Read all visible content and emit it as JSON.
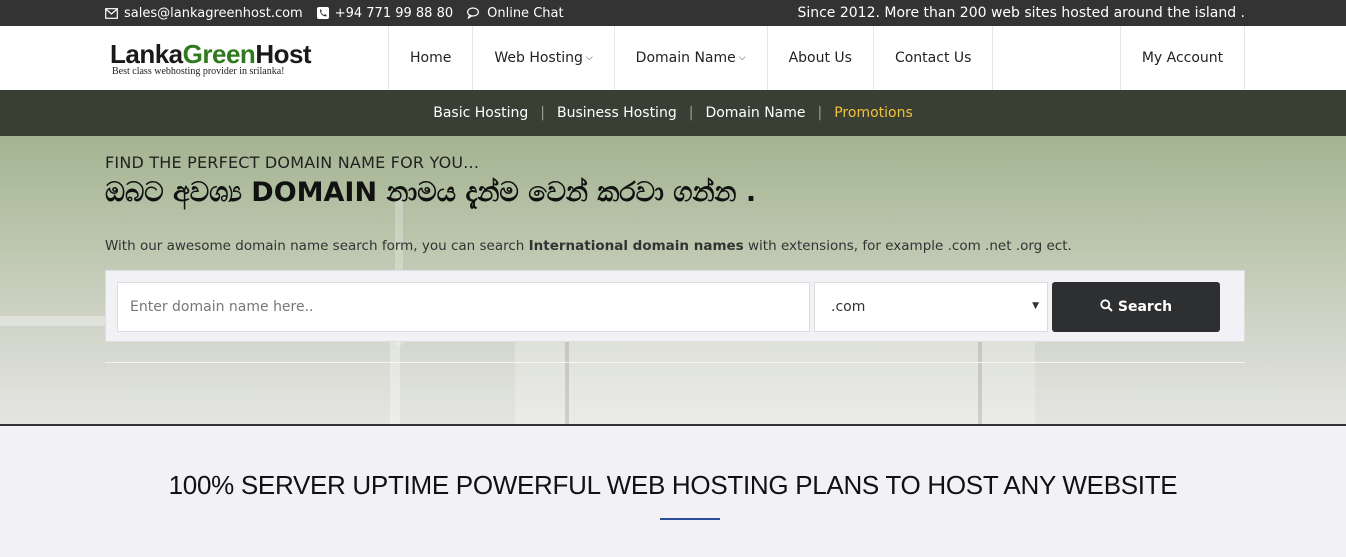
{
  "topbar": {
    "email": "sales@lankagreenhost.com",
    "phone": "+94 771 99 88 80",
    "chat": "Online Chat",
    "since": "Since 2012. More than 200 web sites hosted around the island ."
  },
  "logo": {
    "part1": "Lanka",
    "part2": "Green",
    "part3": "Host",
    "tagline": "Best class webhosting provider in srilanka!"
  },
  "nav": {
    "home": "Home",
    "web_hosting": "Web Hosting",
    "domain_name": "Domain Name",
    "about": "About Us",
    "contact": "Contact Us",
    "account": "My Account"
  },
  "subnav": {
    "basic": "Basic Hosting",
    "business": "Business Hosting",
    "domain": "Domain Name",
    "promotions": "Promotions",
    "separator": "|"
  },
  "hero": {
    "kicker": "FIND THE PERFECT DOMAIN NAME FOR YOU...",
    "headline": "ඔබට අවශ්‍ය DOMAIN නාමය දැන්ම වෙන් කරවා ගන්න .",
    "desc_pre": "With our awesome domain name search form, you can search ",
    "desc_bold": "International domain names",
    "desc_post": " with extensions, for example .com .net .org ect."
  },
  "search": {
    "placeholder": "Enter domain name here..",
    "tld_value": ".com",
    "button_label": "Search"
  },
  "section": {
    "title": "100% SERVER UPTIME POWERFUL WEB HOSTING PLANS TO HOST ANY WEBSITE"
  },
  "colors": {
    "accent_green": "#2f7a1f",
    "subnav_bg": "#3a3f33",
    "promo": "#f0c13d",
    "underline": "#2b4e94"
  }
}
